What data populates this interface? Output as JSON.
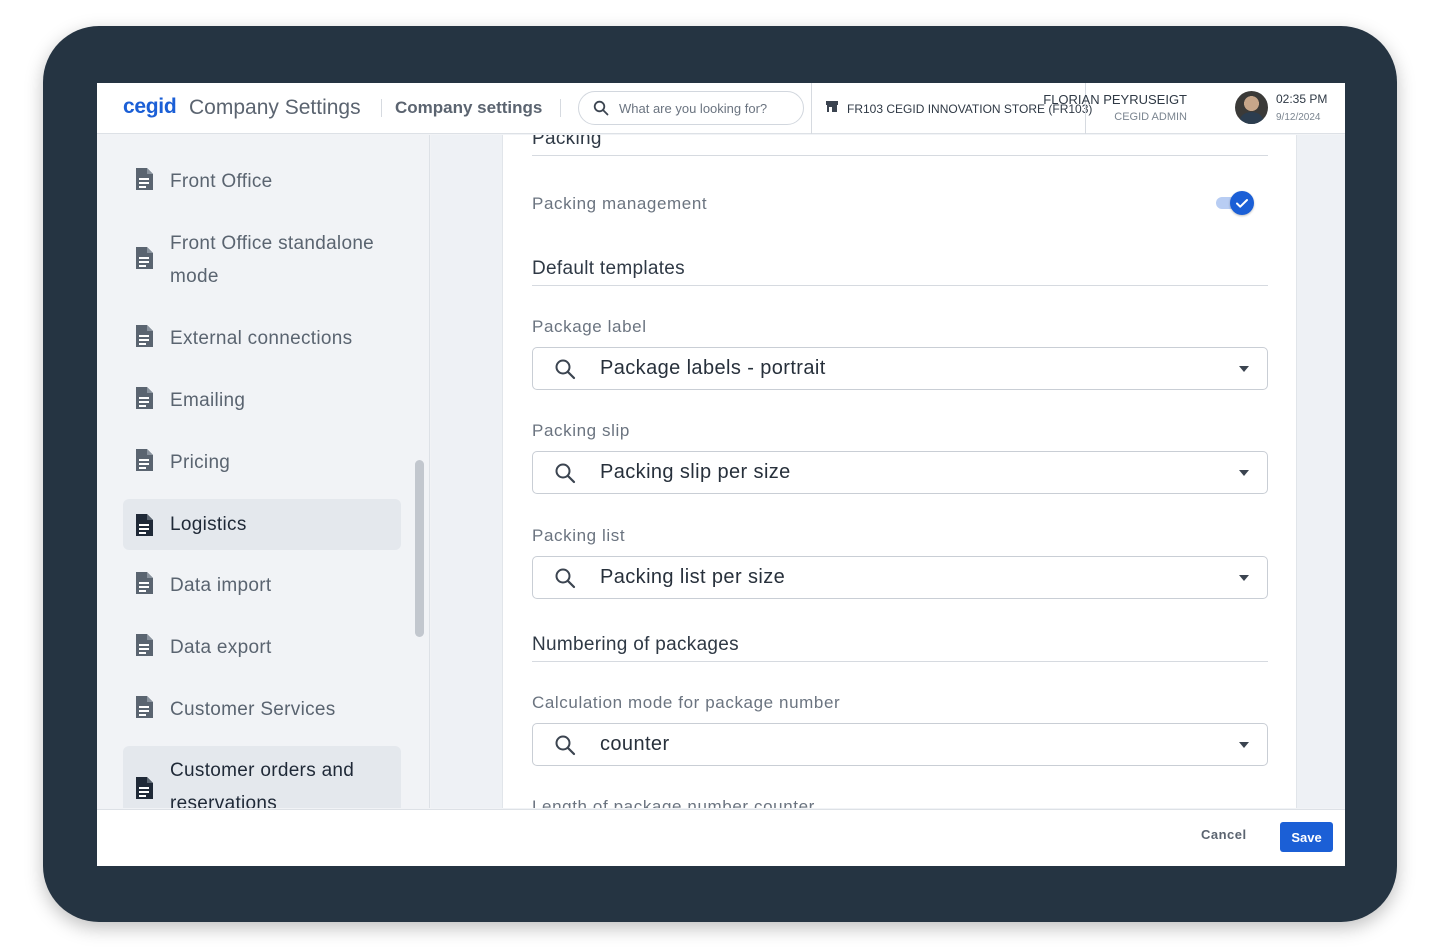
{
  "header": {
    "logo": "cegid",
    "app_title": "Company Settings",
    "breadcrumb": "Company settings",
    "search_placeholder": "What are you looking for?",
    "store": "FR103 CEGID INNOVATION STORE (FR103)",
    "user_name": "FLORIAN PEYRUSEIGT",
    "user_role": "CEGID ADMIN",
    "time": "02:35 PM",
    "date": "9/12/2024"
  },
  "sidebar": {
    "items": [
      {
        "label": "Front Office"
      },
      {
        "label": "Front Office standalone"
      },
      {
        "label": "mode"
      },
      {
        "label": "External connections"
      },
      {
        "label": "Emailing"
      },
      {
        "label": "Pricing"
      },
      {
        "label": "Logistics"
      },
      {
        "label": "Data import"
      },
      {
        "label": "Data export"
      },
      {
        "label": "Customer Services"
      },
      {
        "label": "Customer orders and"
      },
      {
        "label": "reservations"
      }
    ]
  },
  "content": {
    "packing_title": "Packing",
    "packing_management_label": "Packing management",
    "packing_management_enabled": true,
    "default_templates_title": "Default templates",
    "package_label": {
      "label": "Package label",
      "value": "Package labels - portrait"
    },
    "packing_slip": {
      "label": "Packing slip",
      "value": "Packing slip per size"
    },
    "packing_list": {
      "label": "Packing list",
      "value": "Packing list per size"
    },
    "numbering_title": "Numbering of packages",
    "calc_mode": {
      "label": "Calculation mode for package number",
      "value": "counter"
    },
    "length_label": "Length of package number counter"
  },
  "footer": {
    "cancel_label": "Cancel",
    "save_label": "Save"
  },
  "colors": {
    "accent": "#1b5fd6",
    "device_frame": "#253442"
  }
}
